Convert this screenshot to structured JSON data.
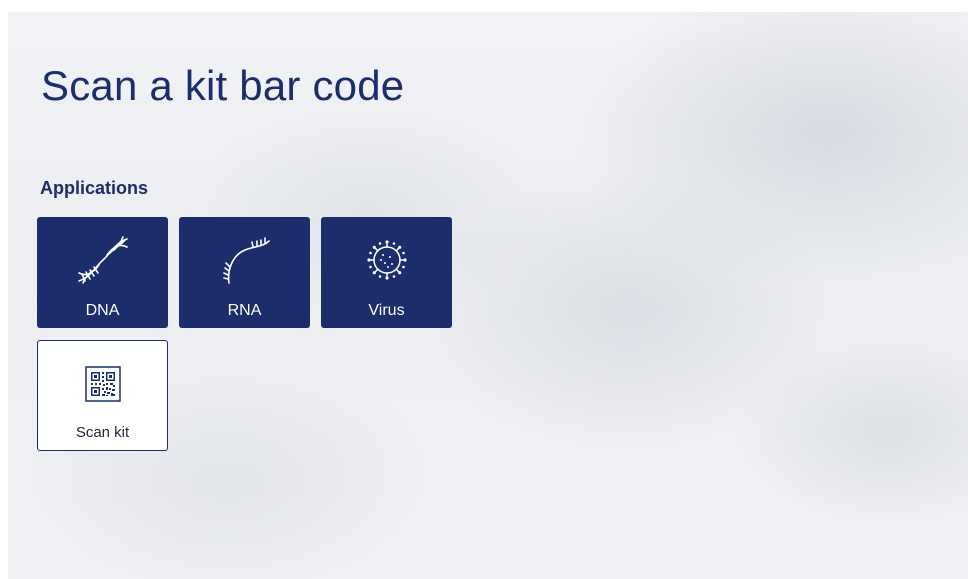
{
  "page": {
    "title": "Scan a kit bar code"
  },
  "applications": {
    "heading": "Applications",
    "tiles": [
      {
        "label": "DNA",
        "icon": "dna-icon",
        "style": "filled"
      },
      {
        "label": "RNA",
        "icon": "rna-icon",
        "style": "filled"
      },
      {
        "label": "Virus",
        "icon": "virus-icon",
        "style": "filled"
      },
      {
        "label": "Scan kit",
        "icon": "qr-code-icon",
        "style": "outline"
      }
    ]
  },
  "colors": {
    "primary": "#1b2d6b",
    "tile_text_on_primary": "#ffffff",
    "outline_tile_bg": "#ffffff",
    "background": "#eceef2"
  }
}
